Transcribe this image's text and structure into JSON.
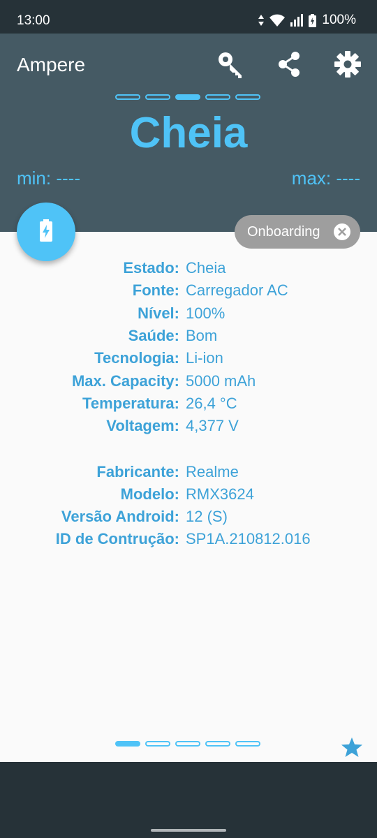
{
  "status_bar": {
    "time": "13:00",
    "battery_percent": "100%"
  },
  "header": {
    "app_title": "Ampere",
    "state": "Cheia",
    "min_label": "min: ----",
    "max_label": "max: ----",
    "pager_active_index": 2,
    "pager_count": 5
  },
  "onboarding_chip": {
    "label": "Onboarding"
  },
  "battery_info": [
    {
      "label": "Estado:",
      "value": "Cheia"
    },
    {
      "label": "Fonte:",
      "value": "Carregador AC"
    },
    {
      "label": "Nível:",
      "value": "100%"
    },
    {
      "label": "Saúde:",
      "value": "Bom"
    },
    {
      "label": "Tecnologia:",
      "value": "Li-ion"
    },
    {
      "label": "Max. Capacity:",
      "value": "5000 mAh"
    },
    {
      "label": "Temperatura:",
      "value": "26,4 °C"
    },
    {
      "label": "Voltagem:",
      "value": "4,377 V"
    }
  ],
  "device_info": [
    {
      "label": "Fabricante:",
      "value": "Realme"
    },
    {
      "label": "Modelo:",
      "value": "RMX3624"
    },
    {
      "label": "Versão Android:",
      "value": "12 (S)"
    },
    {
      "label": "ID de Contrução:",
      "value": "SP1A.210812.016"
    }
  ],
  "bottom_pager": {
    "active_index": 0,
    "count": 5
  },
  "icons": {
    "key": "key-icon",
    "share": "share-icon",
    "settings": "settings-icon",
    "fab": "battery-charging-icon",
    "chip_close": "close-icon",
    "favorite": "star-icon"
  },
  "colors": {
    "accent": "#4fc3f7",
    "header": "#455a64",
    "system_bar": "#263238",
    "chip": "#9e9e9e",
    "text_blue": "#3da2d8"
  }
}
